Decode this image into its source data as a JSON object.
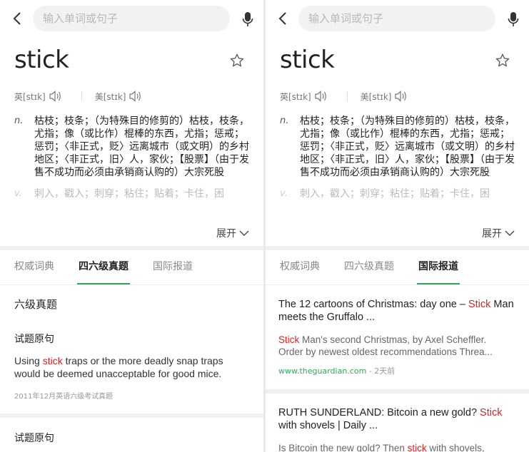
{
  "search": {
    "placeholder": "输入单词或句子"
  },
  "entry": {
    "word": "stick",
    "pron_uk_label": "英[stɪk]",
    "pron_us_label": "美[stɪk]",
    "defs": [
      {
        "pos": "n.",
        "text": "枯枝；枝条；（为特殊目的修剪的）枯枝，枝条，尤指；像（或比作）棍棒的东西，尤指；惩戒；惩罚；〈非正式，贬〉远离城市（或文明）的乡村地区；〈非正式，旧〉人，家伙；【股票】（由于发售不成功而必须由承销商认购的）大宗死股"
      },
      {
        "pos": "v.",
        "text": "刺入，戳入；刺穿；粘住；贴着；卡住，困"
      }
    ],
    "expand_label": "展开"
  },
  "tabs": [
    "权威词典",
    "四六级真题",
    "国际报道"
  ],
  "left": {
    "section_title": "六级真题",
    "sub_title": "试题原句",
    "sentence_before": "Using ",
    "sentence_hl": "stick",
    "sentence_after": " traps or the more deadly snap traps would be deemed unacceptable for good mice.",
    "source": "2011年12月英语六级考试真题",
    "sub_title_2": "试题原句"
  },
  "right": {
    "news": [
      {
        "title_before": "The 12 cartoons of Christmas: day one – ",
        "title_hl": "Stick",
        "title_after": " Man meets the Gruffalo ...",
        "snip_hl": "Stick",
        "snip_l1": " Man's second Christmas, by Axel Scheffler.",
        "snip_l2": "Order by newest oldest recommendations Threa...",
        "domain": "www.theguardian.com",
        "time": " - 2天前"
      },
      {
        "title_before": "RUTH SUNDERLAND: Bitcoin a new gold? ",
        "title_hl": "Stick",
        "title_after": " with shovels | Daily ...",
        "snip_before": "Is Bitcoin the new gold? Then ",
        "snip_hl": "stick",
        "snip_after": " with shovels,"
      }
    ]
  },
  "colors": {
    "accent": "#2fa75a",
    "highlight": "#e02020"
  }
}
